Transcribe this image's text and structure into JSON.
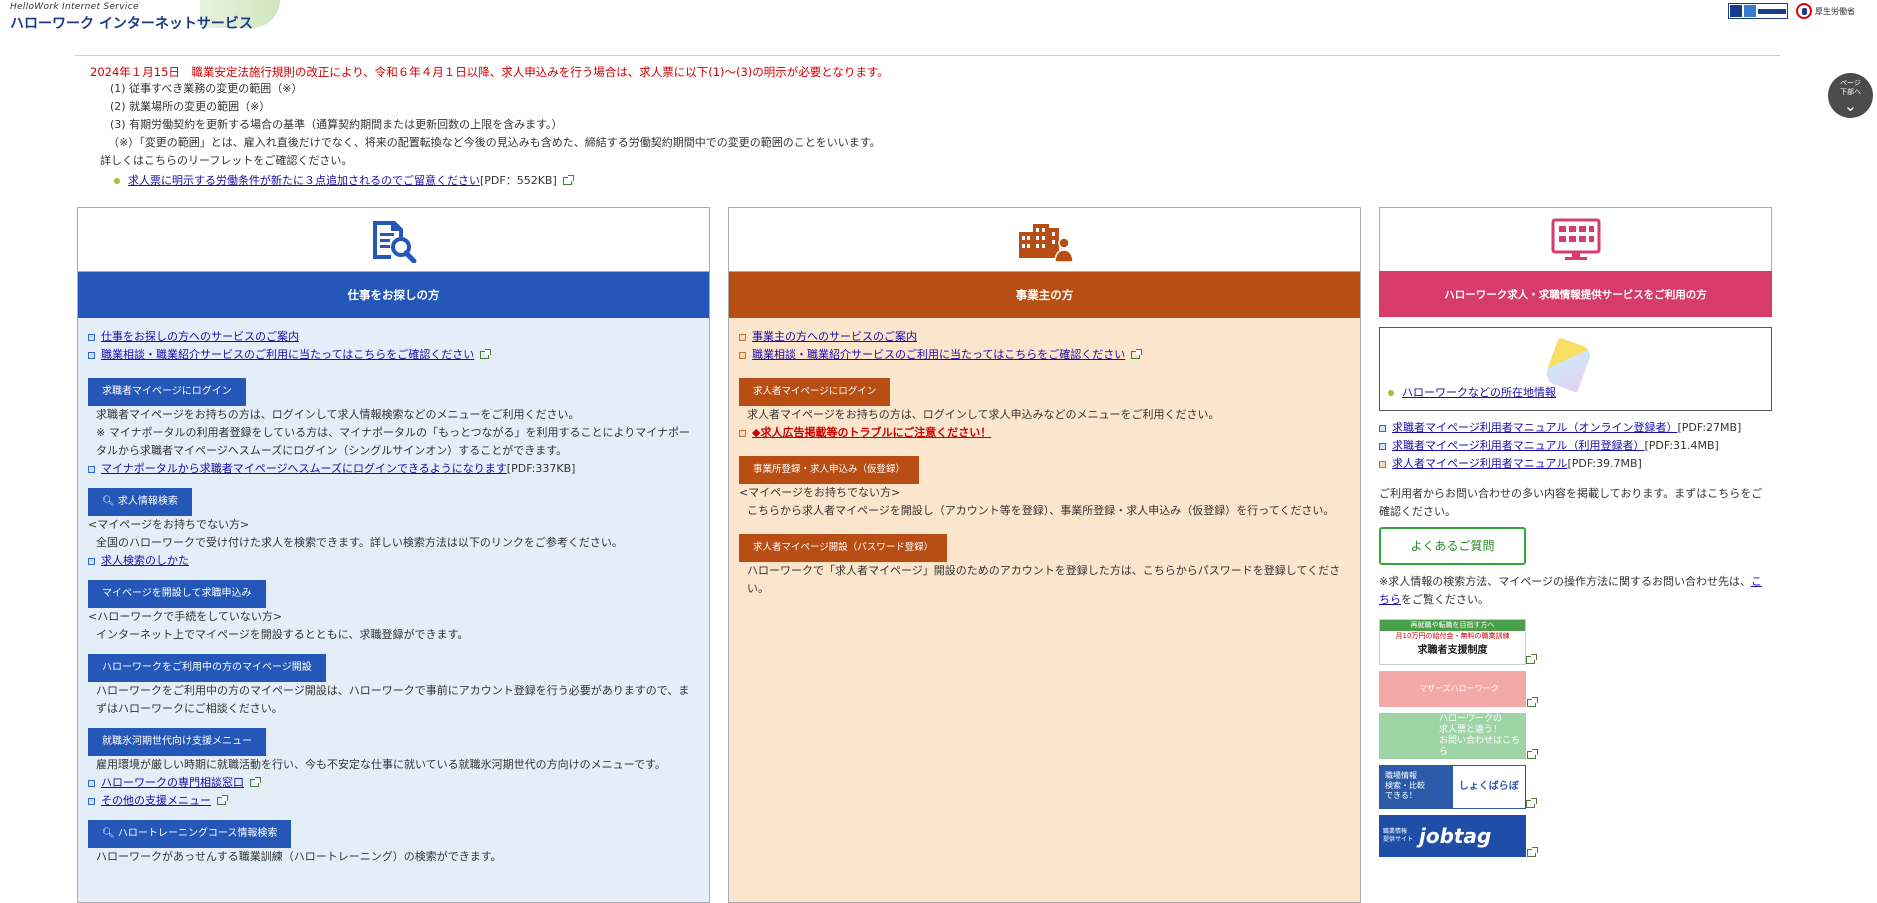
{
  "header": {
    "logo_sub": "HelloWork Internet Service",
    "logo_main": "ハローワーク インターネットサービス",
    "mhlw_label": "厚生労働省"
  },
  "scroll_hint": {
    "label": "ページ\n下部へ"
  },
  "notice": {
    "headline": "2024年１月15日　職業安定法施行規則の改正により、令和６年４月１日以降、求人申込みを行う場合は、求人票に以下(1)～(3)の明示が必要となります。",
    "items": [
      "(1) 従事すべき業務の変更の範囲（※）",
      "(2) 就業場所の変更の範囲（※）",
      "(3) 有期労働契約を更新する場合の基準（通算契約期間または更新回数の上限を含みます。）"
    ],
    "note": "（※）「変更の範囲」とは、雇入れ直後だけでなく、将来の配置転換など今後の見込みも含めた、締結する労働契約期間中での変更の範囲のことをいいます。",
    "detail": "詳しくはこちらのリーフレットをご確認ください。",
    "pdf_link": "求人票に明示する労働条件が新たに３点追加されるのでご留意ください",
    "pdf_size": "[PDF：552KB]"
  },
  "job_seeker": {
    "title": "仕事をお探しの方",
    "links": [
      "仕事をお探しの方へのサービスのご案内",
      "職業相談・職業紹介サービスのご利用に当たってはこちらをご確認ください"
    ],
    "login_btn": "求職者マイページにログイン",
    "login_desc1": "求職者マイページをお持ちの方は、ログインして求人情報検索などのメニューをご利用ください。",
    "login_desc2": "※ マイナポータルの利用者登録をしている方は、マイナポータルの「もっとつながる」を利用することによりマイナポータルから求職者マイページへスムーズにログイン（シングルサインオン）することができます。",
    "mynaportal_link": "マイナポータルから求職者マイページへスムーズにログインできるようになります",
    "mynaportal_size": "[PDF:337KB]",
    "search_btn": "求人情報検索",
    "search_cond": "<マイページをお持ちでない方>",
    "search_desc": "全国のハローワークで受け付けた求人を検索できます。詳しい検索方法は以下のリンクをご参考ください。",
    "search_howto": "求人検索のしかた",
    "open_btn": "マイページを開設して求職申込み",
    "open_cond": "<ハローワークで手続をしていない方>",
    "open_desc": "インターネット上でマイページを開設するとともに、求職登録ができます。",
    "using_btn": "ハローワークをご利用中の方のマイページ開設",
    "using_desc": "ハローワークをご利用中の方のマイページ開設は、ハローワークで事前にアカウント登録を行う必要がありますので、まずはハローワークにご相談ください。",
    "ice_btn": "就職氷河期世代向け支援メニュー",
    "ice_desc": "雇用環境が厳しい時期に就職活動を行い、今も不安定な仕事に就いている就職氷河期世代の方向けのメニューです。",
    "ice_link1": "ハローワークの専門相談窓口",
    "ice_link2": "その他の支援メニュー",
    "training_btn": "ハロートレーニングコース情報検索",
    "training_desc": "ハローワークがあっせんする職業訓練（ハロートレーニング）の検索ができます。"
  },
  "employer": {
    "title": "事業主の方",
    "links": [
      "事業主の方へのサービスのご案内",
      "職業相談・職業紹介サービスのご利用に当たってはこちらをご確認ください"
    ],
    "login_btn": "求人者マイページにログイン",
    "login_desc": "求人者マイページをお持ちの方は、ログインして求人申込みなどのメニューをご利用ください。",
    "warning_link": "求人広告掲載等のトラブルにご注意ください！",
    "reg_btn": "事業所登録・求人申込み（仮登録）",
    "reg_cond": "<マイページをお持ちでない方>",
    "reg_desc": "こちらから求人者マイページを開設し（アカウント等を登録）、事業所登録・求人申込み（仮登録）を行ってください。",
    "pw_btn": "求人者マイページ開設（パスワード登録）",
    "pw_desc": "ハローワークで「求人者マイページ」開設のためのアカウントを登録した方は、こちらからパスワードを登録してください。"
  },
  "service": {
    "title": "ハローワーク求人・求職情報提供サービスをご利用の方",
    "map_link": "ハローワークなどの所在地情報",
    "manuals": [
      {
        "label": "求職者マイページ利用者マニュアル（オンライン登録者）",
        "size": "[PDF:27MB]"
      },
      {
        "label": "求職者マイページ利用者マニュアル（利用登録者）",
        "size": "[PDF:31.4MB]"
      },
      {
        "label": "求人者マイページ利用者マニュアル",
        "size": "[PDF:39.7MB]"
      }
    ],
    "faq_desc": "ご利用者からお問い合わせの多い内容を掲載しております。まずはこちらをご確認ください。",
    "faq_btn": "よくあるご質問",
    "contact_text1": "※求人情報の検索方法、マイページの操作方法に関するお問い合わせ先は、",
    "contact_link": "こちら",
    "contact_text2": "をご覧ください。",
    "banners": {
      "b1_top": "再就職や転職を目指す方へ",
      "b1_mid": "月10万円の給付金・無料の職業訓練",
      "b1_bot": "求職者支援制度",
      "b2": "マザーズハローワーク",
      "b3": "ハローワークの\n求人票と違う！\nお問い合わせはこちら",
      "b4_left": "職場情報\n検索・比較\nできる！",
      "b4_right": "しょくばらぼ",
      "b5_left": "職業情報\n提供サイト",
      "b5_right": "jobtag"
    }
  },
  "colors": {
    "blue": "#2457b8",
    "orange": "#b94e15",
    "pink": "#d63b6c",
    "red": "#d10000"
  }
}
